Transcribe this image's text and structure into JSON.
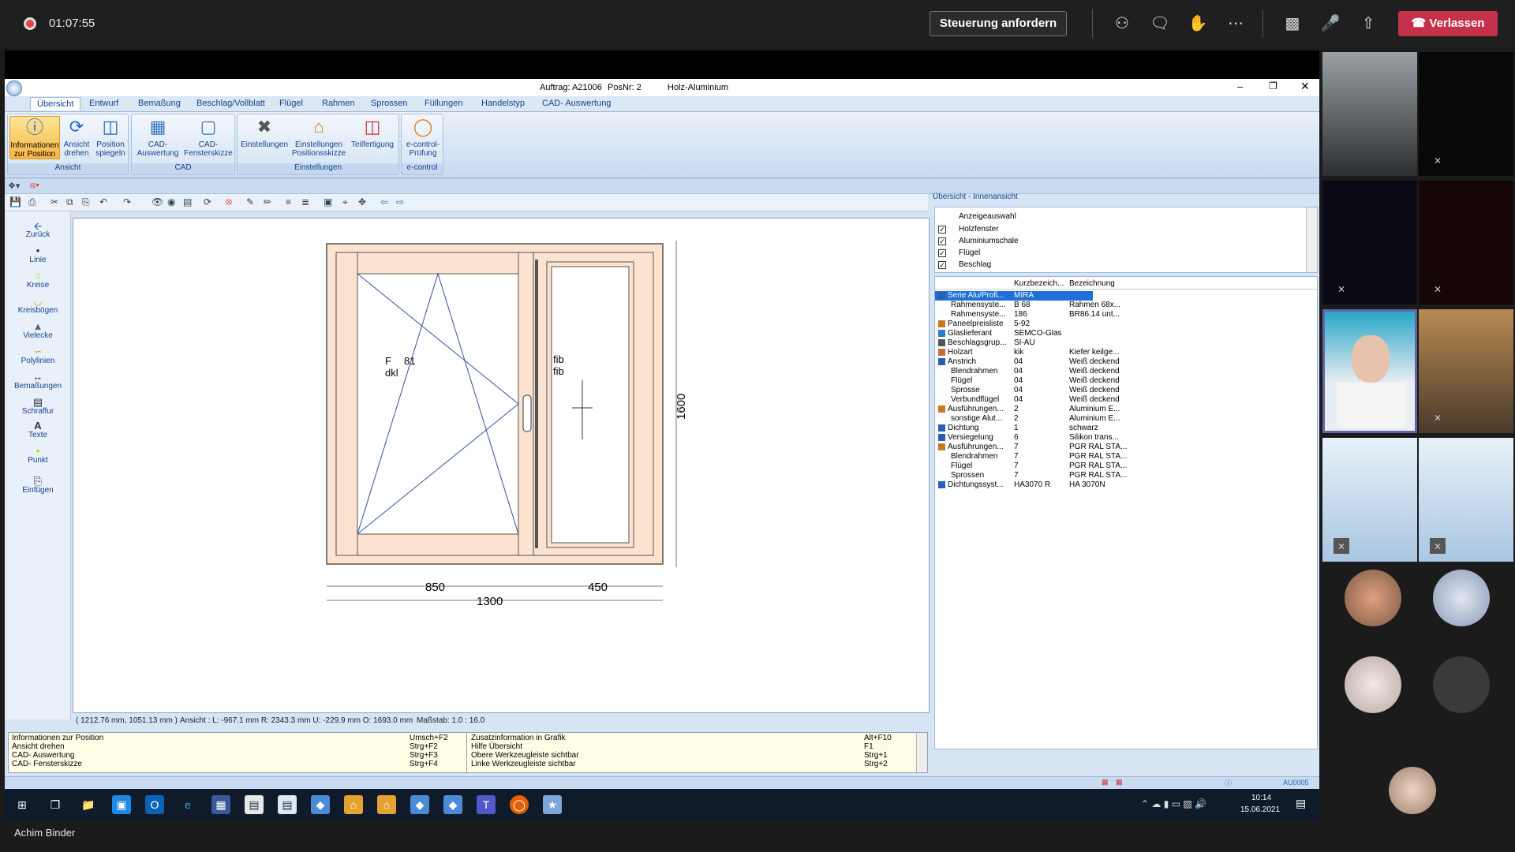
{
  "meeting": {
    "elapsed": "01:07:55",
    "request_control_label": "Steuerung anfordern",
    "leave_label": "Verlassen",
    "presenter_name": "Achim Binder"
  },
  "app": {
    "title_order": "Auftrag: A21006",
    "title_pos": "PosNr: 2",
    "title_material": "Holz-Aluminium",
    "tabs": [
      "Übersicht",
      "Entwurf",
      "Bemaßung",
      "Beschlag/Vollblatt",
      "Flügel",
      "Rahmen",
      "Sprossen",
      "Füllungen",
      "Handelstyp",
      "CAD- Auswertung"
    ],
    "ribbon": {
      "groups": [
        "Ansicht",
        "CAD",
        "Einstellungen",
        "e-control"
      ],
      "buttons": [
        "Informationen zur Position",
        "Ansicht drehen",
        "Position spiegeln",
        "CAD-Auswertung",
        "CAD-Fensterskizze",
        "Einstellungen",
        "Einstellungen Positionsskizze",
        "Teilfertigung",
        "e-control-Prüfung"
      ]
    },
    "left_tools": [
      "Zurück",
      "Linie",
      "Kreise",
      "Kreisbögen",
      "Vielecke",
      "Polylinien",
      "Bemaßungen",
      "Schraffur",
      "Texte",
      "Punkt",
      "Einfügen"
    ],
    "drawing": {
      "sash_label_1": "F",
      "sash_label_1b": "81",
      "sash_label_2": "dkl",
      "fixed_label_1": "fib",
      "fixed_label_2": "fib",
      "dim_height": "1600",
      "dim_left": "850",
      "dim_right": "450",
      "dim_total": "1300"
    },
    "status": {
      "coords": "( 1212.76 mm, 1051.13 mm )",
      "view": "Ansicht : L: -967.1 mm   R: 2343.3 mm   U: -229.9 mm   O: 1693.0 mm",
      "scale": "Maßstab: 1.0 : 16.0"
    },
    "shortcuts_left": [
      {
        "label": "Informationen zur Position",
        "key": "Umsch+F2"
      },
      {
        "label": "Ansicht drehen",
        "key": "Strg+F2"
      },
      {
        "label": "CAD- Auswertung",
        "key": "Strg+F3"
      },
      {
        "label": "CAD- Fensterskizze",
        "key": "Strg+F4"
      }
    ],
    "shortcuts_right": [
      {
        "label": "Zusatzinformation in Grafik",
        "key": "Alt+F10"
      },
      {
        "label": "Hilfe Übersicht",
        "key": "F1"
      },
      {
        "label": "Obere Werkzeugleiste sichtbar",
        "key": "Strg+1"
      },
      {
        "label": "Linke Werkzeugleiste sichtbar",
        "key": "Strg+2"
      }
    ],
    "panel_title": "Übersicht - Innenansicht",
    "display_selection": {
      "header": "Anzeigeauswahl",
      "items": [
        "Holzfenster",
        "Aluminiumschale",
        "Flügel",
        "Beschlag"
      ]
    },
    "table": {
      "col_short": "Kurzbezeich...",
      "col_desc": "Bezeichnung",
      "rows": [
        {
          "name": "Serie Alu/Profi...",
          "short": "MIRA",
          "desc": "",
          "indent": false,
          "selected": true
        },
        {
          "name": "Rahmensyste...",
          "short": "B 68",
          "desc": "Rahmen 68x...",
          "indent": true
        },
        {
          "name": "Rahmensyste...",
          "short": "186",
          "desc": "BR86.14 unt...",
          "indent": true
        },
        {
          "name": "Paneelpreisliste",
          "short": "5-92",
          "desc": "",
          "indent": false
        },
        {
          "name": "Glaslieferant",
          "short": "SEMCO-Glas",
          "desc": "",
          "indent": false
        },
        {
          "name": "Beschlagsgrup...",
          "short": "SI-AU",
          "desc": "",
          "indent": false
        },
        {
          "name": "Holzart",
          "short": "kik",
          "desc": "Kiefer keilge...",
          "indent": false
        },
        {
          "name": "Anstrich",
          "short": "04",
          "desc": "Weiß deckend",
          "indent": false
        },
        {
          "name": "Blendrahmen",
          "short": "04",
          "desc": "Weiß deckend",
          "indent": true
        },
        {
          "name": "Flügel",
          "short": "04",
          "desc": "Weiß deckend",
          "indent": true
        },
        {
          "name": "Sprosse",
          "short": "04",
          "desc": "Weiß deckend",
          "indent": true
        },
        {
          "name": "Verbundflügel",
          "short": "04",
          "desc": "Weiß deckend",
          "indent": true
        },
        {
          "name": "Ausführungen...",
          "short": "2",
          "desc": "Aluminium E...",
          "indent": false
        },
        {
          "name": "sonstige Alut...",
          "short": "2",
          "desc": "Aluminium E...",
          "indent": true
        },
        {
          "name": "Dichtung",
          "short": "1",
          "desc": "schwarz",
          "indent": false
        },
        {
          "name": "Versiegelung",
          "short": "6",
          "desc": "Silikon trans...",
          "indent": false
        },
        {
          "name": "Ausführungen...",
          "short": "7",
          "desc": "PGR RAL STA...",
          "indent": false
        },
        {
          "name": "Blendrahmen",
          "short": "7",
          "desc": "PGR RAL STA...",
          "indent": true
        },
        {
          "name": "Flügel",
          "short": "7",
          "desc": "PGR RAL STA...",
          "indent": true
        },
        {
          "name": "Sprossen",
          "short": "7",
          "desc": "PGR RAL STA...",
          "indent": true
        },
        {
          "name": "Dichtungssyst...",
          "short": "HA3070 R",
          "desc": "HA 3070N",
          "indent": false
        }
      ]
    },
    "status_code": "AU0005"
  },
  "taskbar": {
    "time": "10:14",
    "date": "15.06.2021"
  },
  "colors": {
    "leave": "#c4314b",
    "frame_wood": "#fbe3cf",
    "ribbon_blue": "#15428b"
  }
}
